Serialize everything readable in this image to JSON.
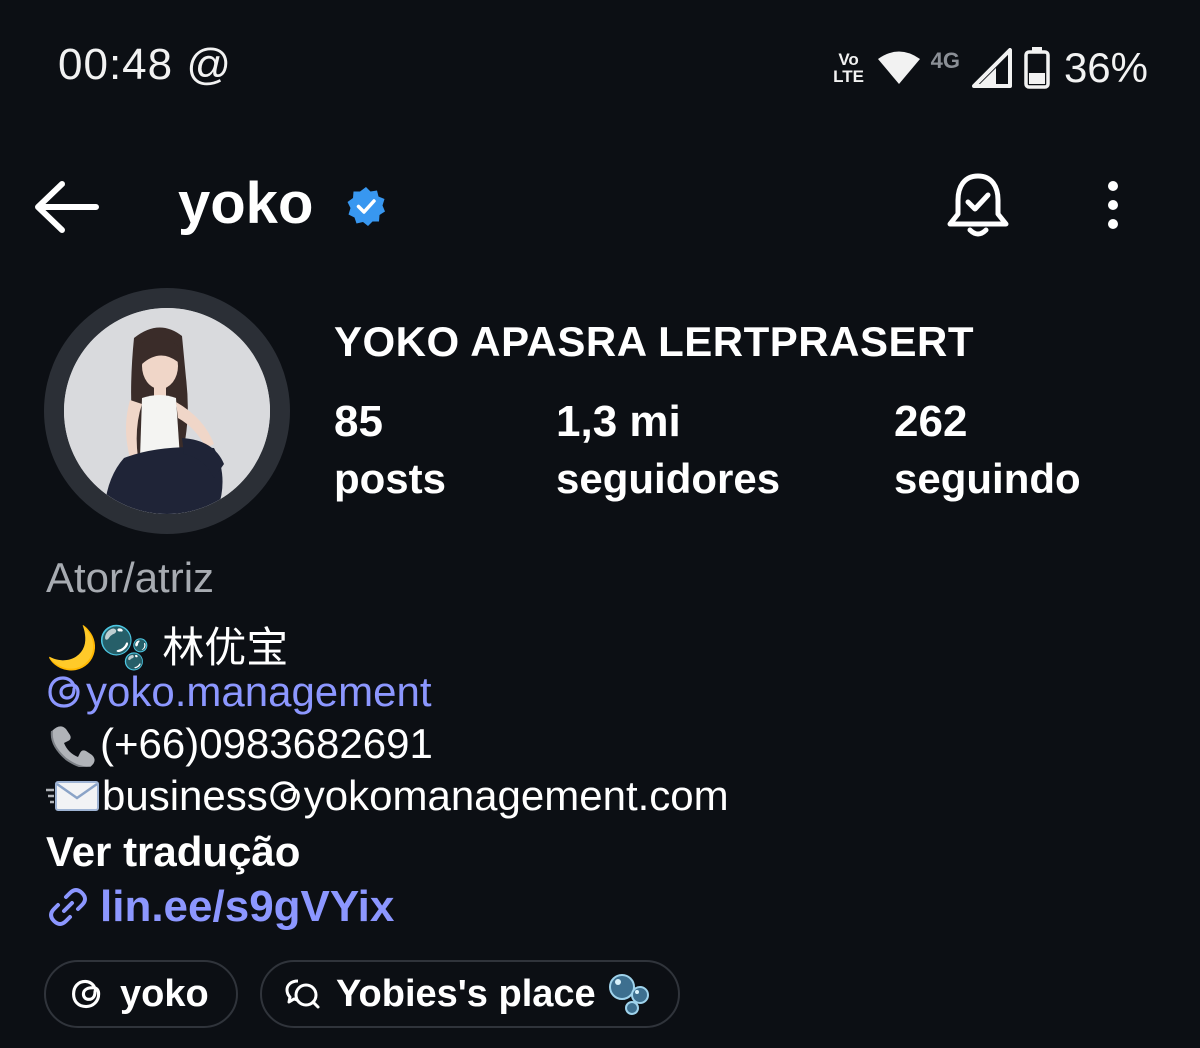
{
  "status_bar": {
    "time": "00:48",
    "at_symbol": "@",
    "volte_top": "Vo",
    "volte_bottom": "LTE",
    "network": "4G",
    "battery": "36%"
  },
  "header": {
    "username": "yoko"
  },
  "profile": {
    "full_name": "YOKO APASRA LERTPRASERT",
    "stats": [
      {
        "value": "85",
        "label": "posts"
      },
      {
        "value": "1,3 mi",
        "label": "seguidores"
      },
      {
        "value": "262",
        "label": "seguindo"
      }
    ],
    "category": "Ator/atriz",
    "bio": {
      "line1": "🌙🫧 林优宝",
      "mention": "yoko.management",
      "phone": "(+66)0983682691",
      "email": " business",
      "email_domain": "yokomanagement.com",
      "translate": "Ver tradução"
    },
    "link": "lin.ee/s9gVYix"
  },
  "chips": [
    {
      "label": "yoko"
    },
    {
      "label": "Yobies's place"
    }
  ],
  "colors": {
    "background": "#0c0f14",
    "accent_link": "#8c97ff",
    "verified_blue": "#3897f0"
  }
}
